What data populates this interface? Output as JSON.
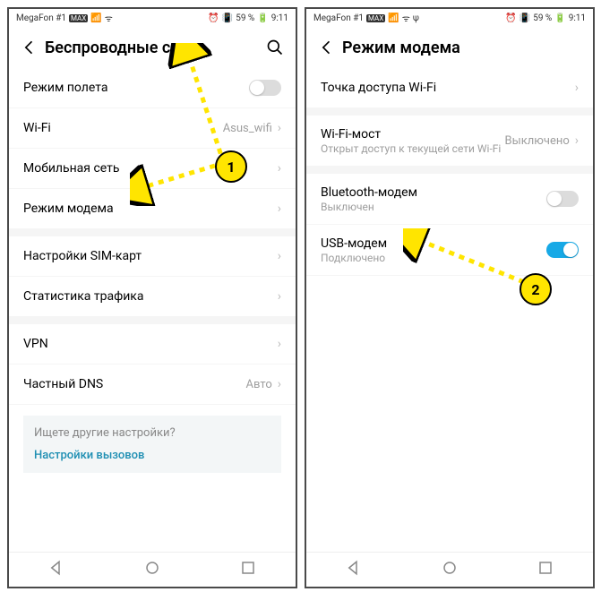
{
  "statusbar": {
    "carrier": "MegaFon #1",
    "badge": "MAX",
    "battery_text": "59 %",
    "time": "9:11"
  },
  "left": {
    "title": "Беспроводные сети",
    "rows": {
      "airplane": "Режим полета",
      "wifi": "Wi-Fi",
      "wifi_value": "Asus_wifi",
      "mobile": "Мобильная сеть",
      "tether": "Режим модема",
      "sim": "Настройки SIM-карт",
      "traffic": "Статистика трафика",
      "vpn": "VPN",
      "dns": "Частный DNS",
      "dns_value": "Авто"
    },
    "hint_q": "Ищете другие настройки?",
    "hint_link": "Настройки вызовов"
  },
  "right": {
    "title": "Режим модема",
    "rows": {
      "hotspot": "Точка доступа Wi-Fi",
      "bridge": "Wi-Fi-мост",
      "bridge_sub": "Открыт доступ к текущей сети Wi-Fi",
      "bridge_value": "Выключено",
      "bt": "Bluetooth-модем",
      "bt_sub": "Выключен",
      "usb": "USB-модем",
      "usb_sub": "Подключено"
    }
  },
  "annotations": {
    "b1": "1",
    "b2": "2"
  }
}
